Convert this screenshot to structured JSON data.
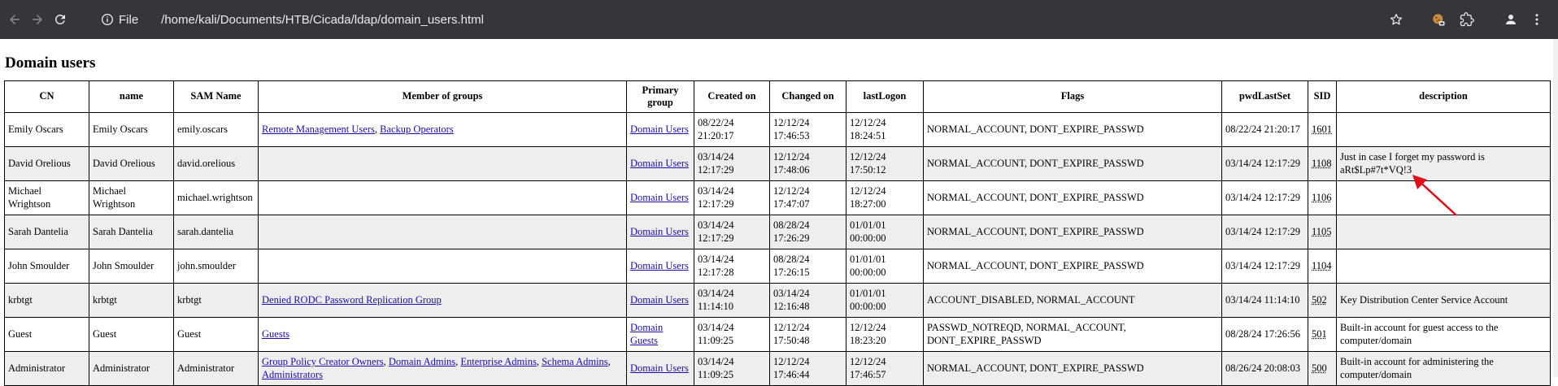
{
  "browser": {
    "scheme_label": "File",
    "url": "/home/kali/Documents/HTB/Cicada/ldap/domain_users.html"
  },
  "page": {
    "title": "Domain users"
  },
  "table": {
    "headers": {
      "cn": "CN",
      "name": "name",
      "sam": "SAM Name",
      "groups": "Member of groups",
      "primary": "Primary group",
      "created": "Created on",
      "changed": "Changed on",
      "lastlogon": "lastLogon",
      "flags": "Flags",
      "pwdlastset": "pwdLastSet",
      "sid": "SID",
      "description": "description"
    },
    "rows": [
      {
        "cn": "Emily Oscars",
        "name": "Emily Oscars",
        "sam": "emily.oscars",
        "groups": [
          "Remote Management Users",
          "Backup Operators"
        ],
        "primary": "Domain Users",
        "created": "08/22/24 21:20:17",
        "changed": "12/12/24 17:46:53",
        "lastlogon": "12/12/24 18:24:51",
        "flags": "NORMAL_ACCOUNT, DONT_EXPIRE_PASSWD",
        "pwdlastset": "08/22/24 21:20:17",
        "sid": "1601",
        "description": ""
      },
      {
        "cn": "David Orelious",
        "name": "David Orelious",
        "sam": "david.orelious",
        "groups": [],
        "primary": "Domain Users",
        "created": "03/14/24 12:17:29",
        "changed": "12/12/24 17:48:06",
        "lastlogon": "12/12/24 17:50:12",
        "flags": "NORMAL_ACCOUNT, DONT_EXPIRE_PASSWD",
        "pwdlastset": "03/14/24 12:17:29",
        "sid": "1108",
        "description": "Just in case I forget my password is aRt$Lp#7t*VQ!3"
      },
      {
        "cn": "Michael Wrightson",
        "name": "Michael Wrightson",
        "sam": "michael.wrightson",
        "groups": [],
        "primary": "Domain Users",
        "created": "03/14/24 12:17:29",
        "changed": "12/12/24 17:47:07",
        "lastlogon": "12/12/24 18:27:00",
        "flags": "NORMAL_ACCOUNT, DONT_EXPIRE_PASSWD",
        "pwdlastset": "03/14/24 12:17:29",
        "sid": "1106",
        "description": ""
      },
      {
        "cn": "Sarah Dantelia",
        "name": "Sarah Dantelia",
        "sam": "sarah.dantelia",
        "groups": [],
        "primary": "Domain Users",
        "created": "03/14/24 12:17:29",
        "changed": "08/28/24 17:26:29",
        "lastlogon": "01/01/01 00:00:00",
        "flags": "NORMAL_ACCOUNT, DONT_EXPIRE_PASSWD",
        "pwdlastset": "03/14/24 12:17:29",
        "sid": "1105",
        "description": ""
      },
      {
        "cn": "John Smoulder",
        "name": "John Smoulder",
        "sam": "john.smoulder",
        "groups": [],
        "primary": "Domain Users",
        "created": "03/14/24 12:17:28",
        "changed": "08/28/24 17:26:15",
        "lastlogon": "01/01/01 00:00:00",
        "flags": "NORMAL_ACCOUNT, DONT_EXPIRE_PASSWD",
        "pwdlastset": "03/14/24 12:17:29",
        "sid": "1104",
        "description": ""
      },
      {
        "cn": "krbtgt",
        "name": "krbtgt",
        "sam": "krbtgt",
        "groups": [
          "Denied RODC Password Replication Group"
        ],
        "primary": "Domain Users",
        "created": "03/14/24 11:14:10",
        "changed": "03/14/24 12:16:48",
        "lastlogon": "01/01/01 00:00:00",
        "flags": "ACCOUNT_DISABLED, NORMAL_ACCOUNT",
        "pwdlastset": "03/14/24 11:14:10",
        "sid": "502",
        "description": "Key Distribution Center Service Account"
      },
      {
        "cn": "Guest",
        "name": "Guest",
        "sam": "Guest",
        "groups": [
          "Guests"
        ],
        "primary": "Domain Guests",
        "created": "03/14/24 11:09:25",
        "changed": "12/12/24 17:50:48",
        "lastlogon": "12/12/24 18:23:20",
        "flags": "PASSWD_NOTREQD, NORMAL_ACCOUNT, DONT_EXPIRE_PASSWD",
        "pwdlastset": "08/28/24 17:26:56",
        "sid": "501",
        "description": "Built-in account for guest access to the computer/domain"
      },
      {
        "cn": "Administrator",
        "name": "Administrator",
        "sam": "Administrator",
        "groups": [
          "Group Policy Creator Owners",
          "Domain Admins",
          "Enterprise Admins",
          "Schema Admins",
          "Administrators"
        ],
        "primary": "Domain Users",
        "created": "03/14/24 11:09:25",
        "changed": "12/12/24 17:46:44",
        "lastlogon": "12/12/24 17:46:57",
        "flags": "NORMAL_ACCOUNT, DONT_EXPIRE_PASSWD",
        "pwdlastset": "08/26/24 20:08:03",
        "sid": "500",
        "description": "Built-in account for administering the computer/domain"
      }
    ]
  },
  "colors": {
    "chrome_bg": "#35363a",
    "chrome_text": "#e8eaed",
    "link": "#1a0dab",
    "row_alt": "#eeeeee",
    "annotation_arrow": "#e0101a"
  },
  "icons": [
    "back-arrow-icon",
    "forward-arrow-icon",
    "reload-icon",
    "info-icon",
    "star-icon",
    "cookie-icon",
    "extensions-icon",
    "profile-icon",
    "menu-icon"
  ]
}
